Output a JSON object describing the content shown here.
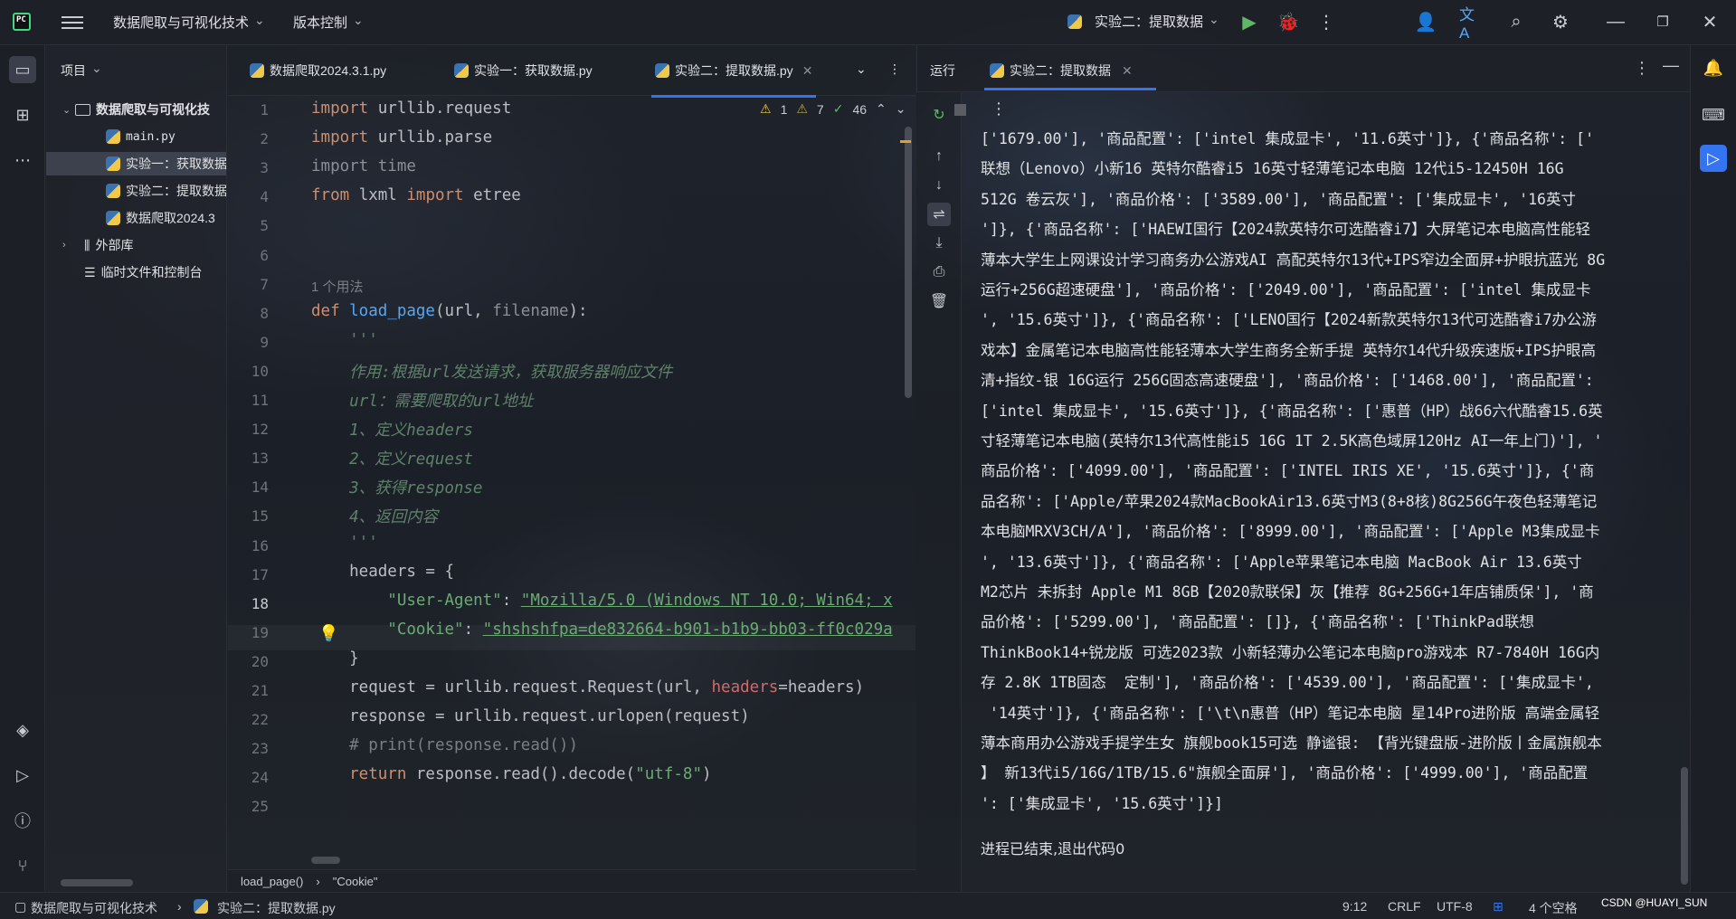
{
  "topbar": {
    "project": "数据爬取与可视化技术",
    "vcs": "版本控制",
    "run_config": "实验二：提取数据"
  },
  "project_panel": {
    "title": "项目",
    "items": [
      {
        "label": "数据爬取与可视化技",
        "type": "folder"
      },
      {
        "label": "main.py",
        "type": "py"
      },
      {
        "label": "实验一：获取数据",
        "type": "py"
      },
      {
        "label": "实验二：提取数据",
        "type": "py"
      },
      {
        "label": "数据爬取2024.3",
        "type": "py"
      },
      {
        "label": "外部库",
        "type": "lib"
      },
      {
        "label": "临时文件和控制台",
        "type": "scratch"
      }
    ]
  },
  "editor": {
    "tabs": [
      "数据爬取2024.3.1.py",
      "实验一：获取数据.py",
      "实验二：提取数据.py"
    ],
    "inspections": {
      "warnings": "1",
      "weak": "7",
      "typos": "46"
    },
    "usage_hint": "1 个用法",
    "lines": [
      "1",
      "2",
      "3",
      "4",
      "5",
      "6",
      "7",
      "8",
      "9",
      "10",
      "11",
      "12",
      "13",
      "14",
      "15",
      "16",
      "17",
      "18",
      "19",
      "20",
      "21",
      "22",
      "23",
      "24",
      "25"
    ],
    "code": {
      "l1_kw": "import",
      "l1_rest": " urllib.request",
      "l2_kw": "import",
      "l2_rest": " urllib.parse",
      "l3": "import time",
      "l4_kw1": "from",
      "l4_mod": " lxml ",
      "l4_kw2": "import",
      "l4_rest": " etree",
      "l7_kw": "def",
      "l7_fn": " load_page",
      "l7_a": "(url, ",
      "l7_b": "filename",
      "l7_c": "):",
      "l8": "    '''",
      "l9": "    作用:根据url发送请求，获取服务器响应文件",
      "l10": "    url：需要爬取的url地址",
      "l11": "    1、定义headers",
      "l12": "    2、定义request",
      "l13": "    3、获得response",
      "l14": "    4、返回内容",
      "l15": "    '''",
      "l16": "    headers = {",
      "l17_k": "        \"User-Agent\"",
      "l17_c": ": ",
      "l17_v": "\"Mozilla/5.0 (Windows NT 10.0; Win64; x",
      "l18_k": "        \"Cookie\"",
      "l18_c": ": ",
      "l18_v": "\"shshshfpa=de832664-b901-b1b9-bb03-ff0c029a",
      "l19": "    }",
      "l20_a": "    request = urllib.request.Request(url, ",
      "l20_p": "headers",
      "l20_b": "=headers)",
      "l21": "    response = urllib.request.urlopen(request)",
      "l22": "    # print(response.read())",
      "l23_kw": "    return",
      "l23_a": " response.read().decode(",
      "l23_s": "\"utf-8\"",
      "l23_b": ")"
    },
    "breadcrumb": [
      "load_page()",
      "\"Cookie\""
    ]
  },
  "run_panel": {
    "tab_run": "运行",
    "tab_config": "实验二：提取数据",
    "output": [
      "['1679.00'], '商品配置': ['intel 集成显卡', '11.6英寸']}, {'商品名称': ['",
      "联想（Lenovo）小新16 英特尔酷睿i5 16英寸轻薄笔记本电脑 12代i5-12450H 16G",
      "512G 卷云灰'], '商品价格': ['3589.00'], '商品配置': ['集成显卡', '16英寸",
      "']}, {'商品名称': ['HAEWI国行【2024款英特尔可选酷睿i7】大屏笔记本电脑高性能轻",
      "薄本大学生上网课设计学习商务办公游戏AI 高配英特尔13代+IPS窄边全面屏+护眼抗蓝光 8G",
      "运行+256G超速硬盘'], '商品价格': ['2049.00'], '商品配置': ['intel 集成显卡",
      "', '15.6英寸']}, {'商品名称': ['LENO国行【2024新款英特尔13代可选酷睿i7办公游",
      "戏本】金属笔记本电脑高性能轻薄本大学生商务全新手提 英特尔14代升级疾速版+IPS护眼高",
      "清+指纹-银 16G运行 256G固态高速硬盘'], '商品价格': ['1468.00'], '商品配置':",
      "['intel 集成显卡', '15.6英寸']}, {'商品名称': ['惠普（HP）战66六代酷睿15.6英",
      "寸轻薄笔记本电脑(英特尔13代高性能i5 16G 1T 2.5K高色域屏120Hz AI一年上门)'], '",
      "商品价格': ['4099.00'], '商品配置': ['INTEL IRIS XE', '15.6英寸']}, {'商",
      "品名称': ['Apple/苹果2024款MacBookAir13.6英寸M3(8+8核)8G256G午夜色轻薄笔记",
      "本电脑MRXV3CH/A'], '商品价格': ['8999.00'], '商品配置': ['Apple M3集成显卡",
      "', '13.6英寸']}, {'商品名称': ['Apple苹果笔记本电脑 MacBook Air 13.6英寸",
      "M2芯片 未拆封 Apple M1 8GB【2020款联保】灰【推荐 8G+256G+1年店铺质保'], '商",
      "品价格': ['5299.00'], '商品配置': []}, {'商品名称': ['ThinkPad联想",
      "ThinkBook14+锐龙版 可选2023款 小新轻薄办公笔记本电脑pro游戏本 R7-7840H 16G内",
      "存 2.8K 1TB固态  定制'], '商品价格': ['4539.00'], '商品配置': ['集成显卡',",
      " '14英寸']}, {'商品名称': ['\\t\\n惠普（HP）笔记本电脑 星14Pro进阶版 高端金属轻",
      "薄本商用办公游戏手提学生女 旗舰book15可选 静谧银: 【背光键盘版-进阶版丨金属旗舰本",
      "】 新13代i5/16G/1TB/15.6\"旗舰全面屏'], '商品价格': ['4999.00'], '商品配置",
      "': ['集成显卡', '15.6英寸']}]"
    ],
    "exit_message": "进程已结束,退出代码0"
  },
  "status_bar": {
    "crumb_project": "数据爬取与可视化技术",
    "crumb_file": "实验二：提取数据.py",
    "position": "9:12",
    "line_sep": "CRLF",
    "encoding": "UTF-8",
    "indent": "4 个空格",
    "watermark": "CSDN @HUAYI_SUN"
  }
}
